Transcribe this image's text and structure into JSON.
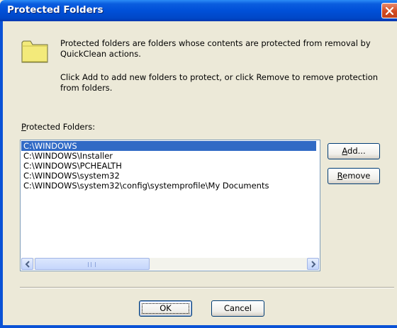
{
  "window": {
    "title": "Protected Folders"
  },
  "description": {
    "line1": "Protected folders are folders whose contents are protected from removal by QuickClean actions.",
    "line2": "Click Add to add new folders to protect, or click Remove to remove protection from folders."
  },
  "list": {
    "label_prefix": "",
    "label_accel": "P",
    "label_rest": "rotected Folders:",
    "items": [
      "C:\\WINDOWS",
      "C:\\WINDOWS\\Installer",
      "C:\\WINDOWS\\PCHEALTH",
      "C:\\WINDOWS\\system32",
      "C:\\WINDOWS\\system32\\config\\systemprofile\\My Documents"
    ],
    "selected_index": 0
  },
  "buttons": {
    "add_accel": "A",
    "add_rest": "dd...",
    "remove_accel": "R",
    "remove_rest": "emove",
    "ok": "OK",
    "cancel": "Cancel"
  },
  "colors": {
    "selection": "#316ac5",
    "title_bar": "#0050d8",
    "dialog_bg": "#ece9d8"
  }
}
